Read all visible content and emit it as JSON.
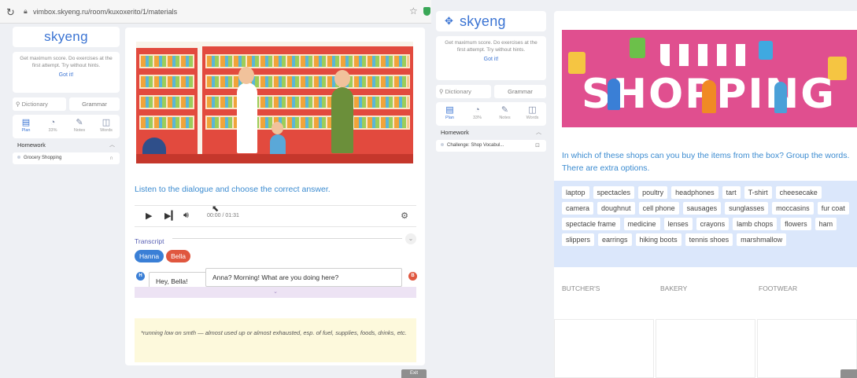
{
  "browser": {
    "url": "vimbox.skyeng.ru/room/kuxoxerito/1/materials",
    "reload_icon": "reload-icon",
    "lock_icon": "lock-icon",
    "star_icon": "star-icon"
  },
  "left": {
    "sidebar": {
      "logo": "skyeng",
      "tip": "Get maximum score. Do exercises at the first attempt. Try without hints.",
      "tip_action": "Got it!",
      "dictionary": "Dictionary",
      "grammar": "Grammar",
      "tools": [
        {
          "icon": "plan-icon",
          "label": "Plan"
        },
        {
          "icon": "progress-icon",
          "label": "33%"
        },
        {
          "icon": "pen-icon",
          "label": "Notes"
        },
        {
          "icon": "book-icon",
          "label": "Words"
        }
      ],
      "section": "Homework",
      "items": [
        "Grocery Shopping"
      ]
    },
    "exercise": {
      "instruction": "Listen to the dialogue and choose the correct answer.",
      "player_time": "00:00 / 01:31",
      "transcript_label": "Transcript",
      "speakers": [
        "Hanna",
        "Bella"
      ],
      "speaker_initials": [
        "H",
        "B"
      ],
      "lines": [
        {
          "speaker": "H",
          "text": "Hey, Bella!"
        },
        {
          "speaker": "B",
          "text": "Anna? Morning! What are you doing here?"
        }
      ],
      "note": "*running low on smth — almost used up or almost exhausted, esp. of fuel, supplies, foods, drinks, etc.",
      "exit": "Exit"
    }
  },
  "right": {
    "sidebar": {
      "logo": "skyeng",
      "tip": "Get maximum score. Do exercises at the first attempt. Try without hints.",
      "tip_action": "Got it!",
      "dictionary": "Dictionary",
      "grammar": "Grammar",
      "tools": [
        {
          "icon": "plan-icon",
          "label": "Plan"
        },
        {
          "icon": "progress-icon",
          "label": "33%"
        },
        {
          "icon": "pen-icon",
          "label": "Notes"
        },
        {
          "icon": "book-icon",
          "label": "Words"
        }
      ],
      "section": "Homework",
      "items": [
        "Challenge: Shop Vocabul..."
      ]
    },
    "exercise": {
      "banner_title": "SHOPPING",
      "instruction": "In which of these shops can you buy the items from the box? Group the words. There are extra options.",
      "words": [
        "laptop",
        "spectacles",
        "poultry",
        "headphones",
        "tart",
        "T-shirt",
        "cheesecake",
        "camera",
        "doughnut",
        "cell phone",
        "sausages",
        "sunglasses",
        "moccasins",
        "fur coat",
        "spectacle frame",
        "medicine",
        "lenses",
        "crayons",
        "lamb chops",
        "flowers",
        "ham",
        "slippers",
        "earrings",
        "hiking boots",
        "tennis shoes",
        "marshmallow"
      ],
      "categories": [
        "BUTCHER'S",
        "BAKERY",
        "FOOTWEAR"
      ]
    }
  }
}
